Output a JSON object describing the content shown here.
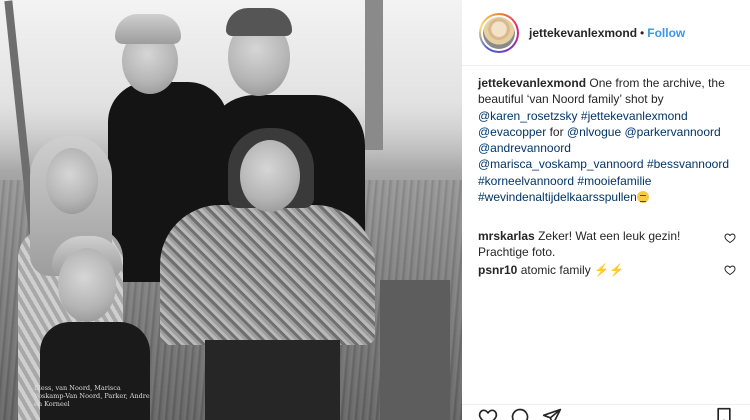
{
  "post": {
    "username": "jettekevanlexmond",
    "separator": "•",
    "follow_label": "Follow",
    "caption_parts": [
      {
        "type": "user",
        "text": "jettekevanlexmond"
      },
      {
        "type": "text",
        "text": " One from the archive, the beautiful ‘van Noord family’ shot by "
      },
      {
        "type": "link",
        "text": "@karen_rosetzsky"
      },
      {
        "type": "text",
        "text": " "
      },
      {
        "type": "link",
        "text": "#jettekevanlexmond"
      },
      {
        "type": "text",
        "text": " "
      },
      {
        "type": "link",
        "text": "@evacopper"
      },
      {
        "type": "text",
        "text": " for "
      },
      {
        "type": "link",
        "text": "@nlvogue"
      },
      {
        "type": "text",
        "text": " "
      },
      {
        "type": "link",
        "text": "@parkervannoord"
      },
      {
        "type": "text",
        "text": " "
      },
      {
        "type": "link",
        "text": "@andrevannoord"
      },
      {
        "type": "text",
        "text": " "
      },
      {
        "type": "link",
        "text": "@marisca_voskamp_vannoord"
      },
      {
        "type": "text",
        "text": " "
      },
      {
        "type": "link",
        "text": "#bessvannoord"
      },
      {
        "type": "text",
        "text": " "
      },
      {
        "type": "link",
        "text": "#korneelvannoord"
      },
      {
        "type": "text",
        "text": " "
      },
      {
        "type": "link",
        "text": "#mooiefamilie"
      },
      {
        "type": "text",
        "text": " "
      },
      {
        "type": "link",
        "text": "#wevindenaltijdelkaarsspullen"
      },
      {
        "type": "emoji",
        "text": "",
        "icon": "grimace-emoji"
      }
    ]
  },
  "comments": [
    {
      "user": "mrskarlas",
      "text": "Zeker! Wat een leuk gezin! Prachtige foto."
    },
    {
      "user": "psnr10",
      "text": "atomic family",
      "suffix": "⚡⚡"
    }
  ],
  "photo": {
    "caption_text": "Bless, van Noord, Marisca Voskamp-Van Noord, Parker, Andre en Korneel"
  },
  "icons": {
    "like": "heart-icon",
    "comment": "comment-icon",
    "share": "share-icon",
    "save": "bookmark-icon"
  },
  "colors": {
    "link": "#003569",
    "follow": "#3897f0",
    "text": "#262626",
    "border": "#efefef"
  }
}
